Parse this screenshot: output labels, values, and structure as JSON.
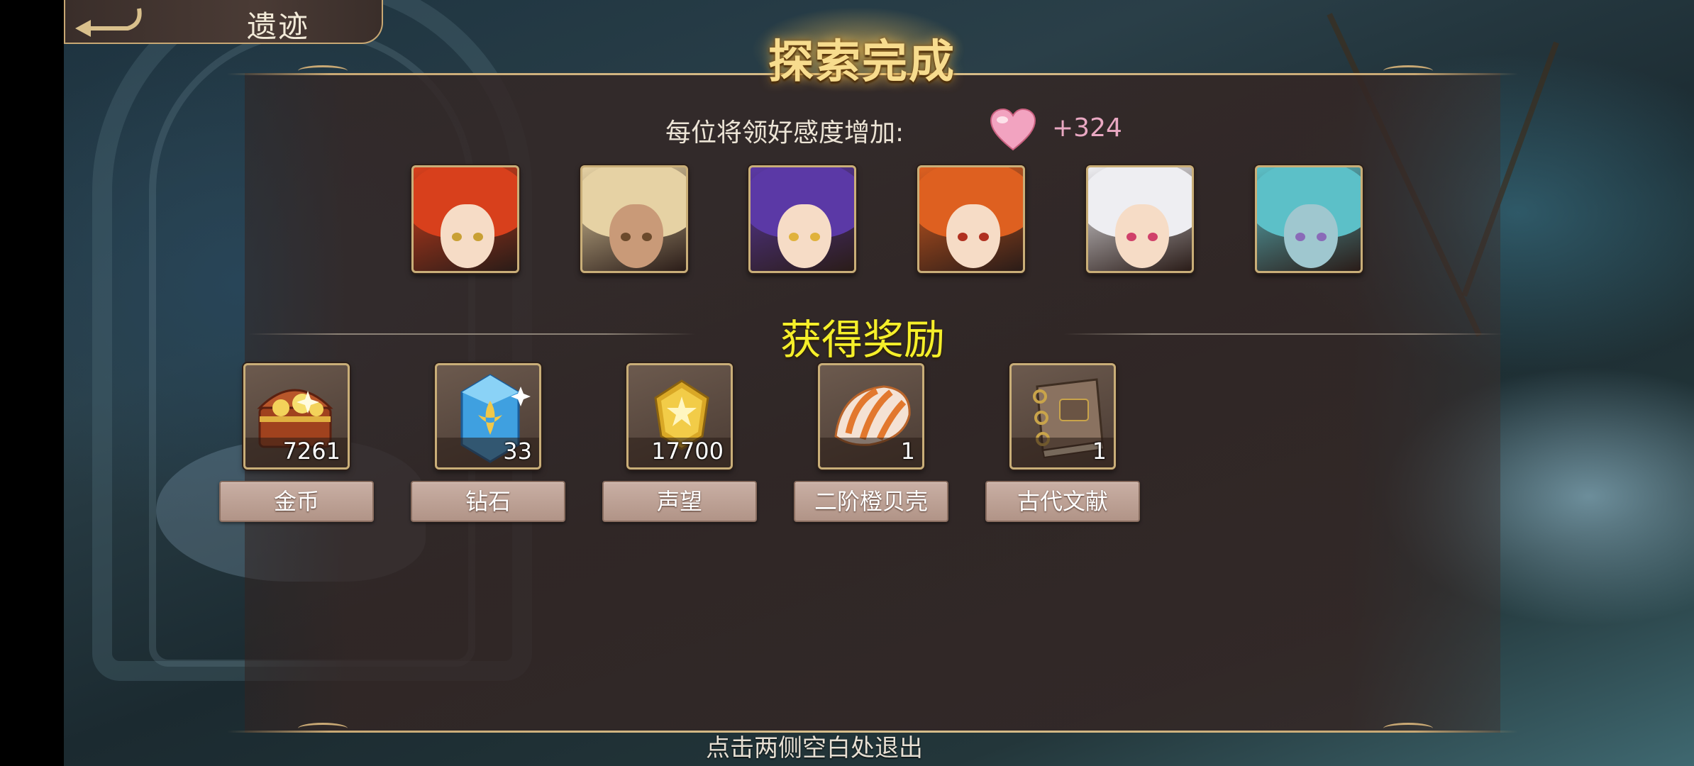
{
  "top_bar": {
    "title": "遗迹"
  },
  "header": {
    "title": "探索完成"
  },
  "affection": {
    "label": "每位将领好感度增加:",
    "value": "+324"
  },
  "heroes": [
    {
      "hair": "#d8401c",
      "eye": "#c9a034"
    },
    {
      "hair": "#e6d2a4",
      "eye": "#6b4a2c"
    },
    {
      "hair": "#5b39a6",
      "eye": "#e0b23c"
    },
    {
      "hair": "#de6020",
      "eye": "#b03020"
    },
    {
      "hair": "#eeeef2",
      "eye": "#d0406a"
    },
    {
      "hair": "#5cc0c8",
      "eye": "#8a6ab8"
    }
  ],
  "rewards": {
    "title": "获得奖励",
    "items": [
      {
        "icon": "treasure-chest-icon",
        "quantity": "7261",
        "name": "金币"
      },
      {
        "icon": "blue-crystal-icon",
        "quantity": "33",
        "name": "钻石"
      },
      {
        "icon": "gold-badge-icon",
        "quantity": "17700",
        "name": "声望"
      },
      {
        "icon": "orange-shell-icon",
        "quantity": "1",
        "name": "二阶橙贝壳"
      },
      {
        "icon": "ancient-book-icon",
        "quantity": "1",
        "name": "古代文献"
      }
    ]
  },
  "footer": {
    "hint": "点击两侧空白处退出"
  },
  "colors": {
    "gold_frame": "#c9ae78",
    "reward_title": "#f5ef2a",
    "affection_value": "#e9a8c2"
  }
}
